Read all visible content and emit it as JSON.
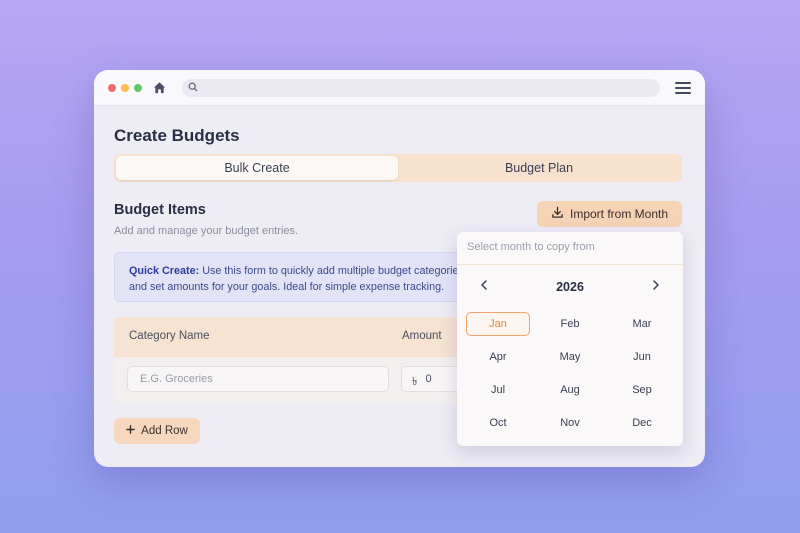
{
  "window": {
    "url_placeholder": ""
  },
  "page": {
    "title": "Create Budgets"
  },
  "tabs": [
    {
      "label": "Bulk Create",
      "active": true
    },
    {
      "label": "Budget Plan",
      "active": false
    }
  ],
  "section": {
    "title": "Budget Items",
    "subtitle": "Add and manage your budget entries."
  },
  "import_button": {
    "label": "Import from Month"
  },
  "info": {
    "strong": "Quick Create:",
    "text": "Use this form to quickly add multiple budget categories and set amounts for your goals. Ideal for simple expense tracking."
  },
  "table": {
    "headers": {
      "category": "Category Name",
      "amount": "Amount"
    },
    "row": {
      "category_placeholder": "E.G. Groceries",
      "currency": "৳",
      "amount": "0"
    }
  },
  "add_row": {
    "label": "Add Row"
  },
  "month_picker": {
    "placeholder": "Select month to copy from",
    "year": "2026",
    "months": [
      "Jan",
      "Feb",
      "Mar",
      "Apr",
      "May",
      "Jun",
      "Jul",
      "Aug",
      "Sep",
      "Oct",
      "Nov",
      "Dec"
    ],
    "selected": "Jan"
  },
  "colors": {
    "accent": "#f7d3b6",
    "selected_month": "#e08a44",
    "info_text": "#3b4a8a"
  }
}
